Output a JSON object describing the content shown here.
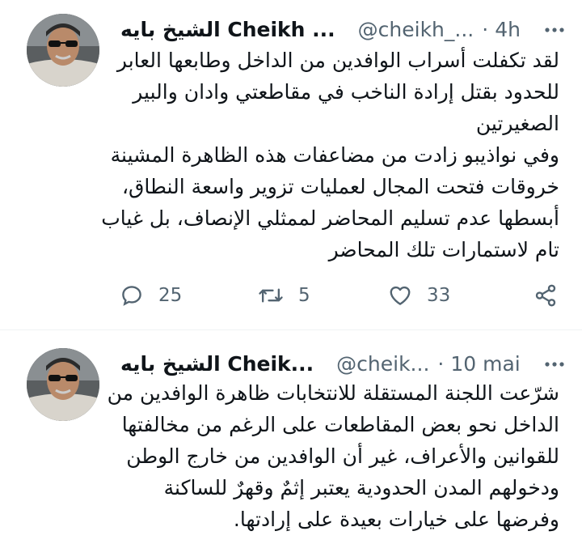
{
  "tweets": [
    {
      "name": "الشيخ بايه Cheikh ...",
      "handle": "@cheikh_...",
      "separator": "·",
      "time": "4h",
      "lines": [
        "لقد تكفلت أسراب الوافدين من الداخل وطابعها العابر",
        "للحدود بقتل إرادة الناخب في مقاطعتي وادان والبير",
        "الصغيرتين",
        "وفي نواذيبو زادت من مضاعفات هذه الظاهرة المشينة",
        "خروقات فتحت المجال لعمليات تزوير واسعة النطاق،",
        "أبسطها عدم تسليم المحاضر لممثلي الإنصاف، بل غياب",
        "تام لاستمارات تلك المحاضر"
      ],
      "replies": "25",
      "retweets": "5",
      "likes": "33"
    },
    {
      "name": "الشيخ بايه Cheik...",
      "handle": "@cheik...",
      "separator": "·",
      "time": "10 mai",
      "lines": [
        "شرّعت اللجنة المستقلة للانتخابات ظاهرة الوافدين من",
        "الداخل نحو بعض المقاطعات  على الرغم من مخالفتها",
        "للقوانين والأعراف، غير أن الوافدين من خارج الوطن",
        "ودخولهم المدن الحدودية يعتبر إثمٌ وقهرٌ للساكنة",
        "وفرضها على خيارات بعيدة على إرادتها."
      ]
    }
  ],
  "icons": {
    "more": "more-dots-icon",
    "reply": "reply-icon",
    "retweet": "retweet-icon",
    "like": "heart-icon",
    "share": "share-icon"
  },
  "colors": {
    "text": "#0f1419",
    "secondary": "#536471",
    "divider": "#eff3f4"
  }
}
